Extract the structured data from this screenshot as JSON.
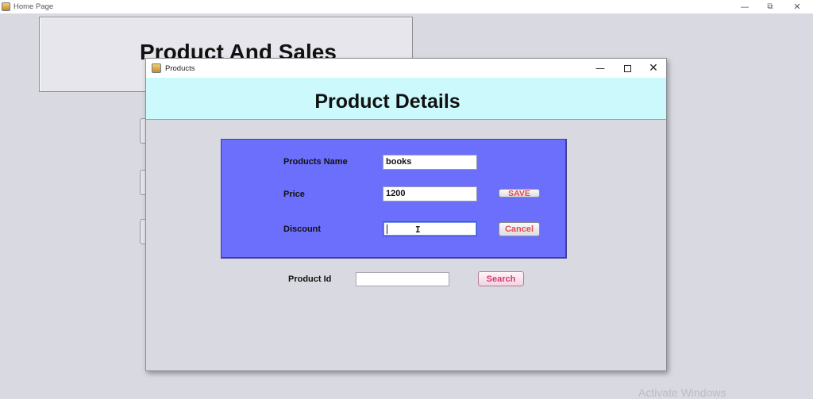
{
  "outer_window": {
    "title": "Home Page",
    "header_title": "Product And Sales",
    "controls": {
      "minimize": "—",
      "restore": "⧉",
      "close": "✕"
    }
  },
  "dialog": {
    "title": "Products",
    "header_title": "Product Details",
    "controls": {
      "minimize": "—",
      "close": "✕"
    },
    "form": {
      "name_label": "Products Name",
      "name_value": "books",
      "price_label": "Price",
      "price_value": "1200",
      "discount_label": "Discount",
      "discount_value": "",
      "save_label": "SAVE",
      "cancel_label": "Cancel"
    },
    "search": {
      "label": "Product Id",
      "value": "",
      "button_label": "Search"
    }
  },
  "watermark": "Activate Windows",
  "colors": {
    "form_panel": "#6b6ffc",
    "header_bg": "#ccfafc",
    "button_text": "#e5484d",
    "search_text": "#d23a74"
  }
}
